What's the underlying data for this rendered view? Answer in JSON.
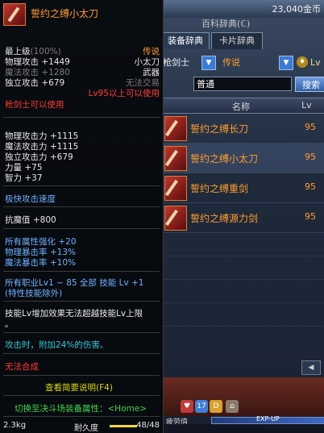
{
  "background_window": {
    "gold": "23,040金币",
    "title_partial": "百科辞典(ℂ)",
    "tabs": [
      "装备辞典",
      "卡片辞典"
    ],
    "filter": {
      "class": "枪剑士",
      "grade": "传说",
      "lv_label": "Lv"
    },
    "search": {
      "value": "普通",
      "button": "搜索"
    },
    "list_header": {
      "name": "名称",
      "lv": "Lv"
    },
    "items": [
      {
        "name": "誓约之缚长刀",
        "lv": "95"
      },
      {
        "name": "誓约之缚小太刀",
        "lv": "95"
      },
      {
        "name": "誓约之缚重剑",
        "lv": "95"
      },
      {
        "name": "誓约之缚源力剑",
        "lv": "95"
      }
    ],
    "scroll_arrow": "◀",
    "taskbar_icons": [
      "17",
      "D"
    ],
    "fatigue_label": "疲劳值",
    "exp_label": "EXP-UP"
  },
  "tooltip": {
    "item_name": "誓约之缚小太刀",
    "top_level": "最上级",
    "top_level_pct": "(100%)",
    "grade": "传说",
    "type1": "小太刀",
    "type2": "武器",
    "trade": "无法交易",
    "phys_atk_label": "物理攻击",
    "phys_atk_val": "+1449",
    "mag_atk_label": "魔法攻击",
    "mag_atk_val": "+1280",
    "ind_atk_label": "独立攻击",
    "ind_atk_val": "+679",
    "level_req": "Lv95以上可以使用",
    "class_req": "枪剑士可以使用",
    "stats": [
      "物理攻击力 +1115",
      "魔法攻击力 +1115",
      "独立攻击力 +679",
      "力量 +75",
      "智力 +37"
    ],
    "speed": "极快攻击速度",
    "anti_magic": "抗魔值 +800",
    "elem": [
      "所有属性强化 +20",
      "物理暴击率 +13%",
      "魔法暴击率 +10%"
    ],
    "skill1": "所有职业Lv1 ~ 85 全部 技能 Lv +1",
    "skill2": "(特性技能除外)",
    "skill_desc1": "技能Lv增加效果无法超越技能Lv上限",
    "skill_desc2": "。",
    "attack_effect": "攻击时，附加24%的伤害。",
    "no_synth": "无法合成",
    "summary_btn": "查看简要说明(F4)",
    "switch_btn": "切换至决斗场装备属性：<Home>",
    "weight": "2.3kg",
    "durability_label": "耐久度",
    "durability_val": "48/48"
  }
}
